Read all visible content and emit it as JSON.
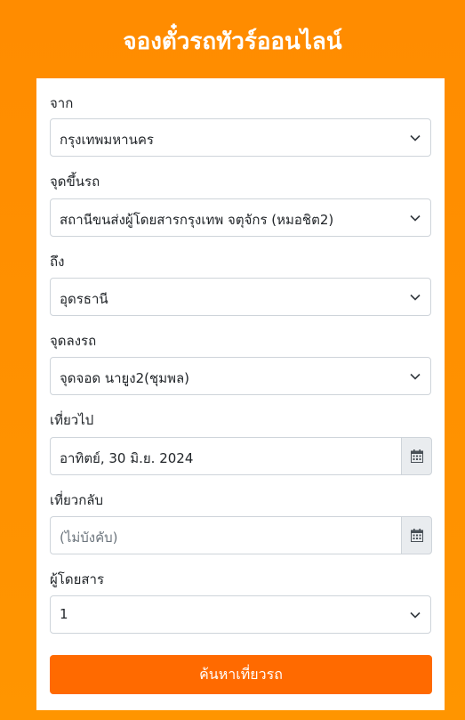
{
  "page_title": "จองตั๋วรถทัวร์ออนไลน์",
  "form": {
    "from": {
      "label": "จาก",
      "value": "กรุงเทพมหานคร"
    },
    "boarding": {
      "label": "จุดขึ้นรถ",
      "value": "สถานีขนส่งผู้โดยสารกรุงเทพ จตุจักร (หมอชิต2)"
    },
    "to": {
      "label": "ถึง",
      "value": "อุดรธานี"
    },
    "dropoff": {
      "label": "จุดลงรถ",
      "value": "จุดจอด นายูง2(ชุมพล)"
    },
    "depart": {
      "label": "เที่ยวไป",
      "value": "อาทิตย์, 30 มิ.ย. 2024"
    },
    "return": {
      "label": "เที่ยวกลับ",
      "placeholder": "(ไม่บังคับ)"
    },
    "passengers": {
      "label": "ผู้โดยสาร",
      "value": "1"
    },
    "search_label": "ค้นหาเที่ยวรถ"
  },
  "icons": {
    "select_arrow": "chevron-down-icon",
    "date_picker": "calendar-icon"
  },
  "colors": {
    "background": "#ff8c00",
    "button": "#ff6a00",
    "addon": "#e9ecef"
  }
}
